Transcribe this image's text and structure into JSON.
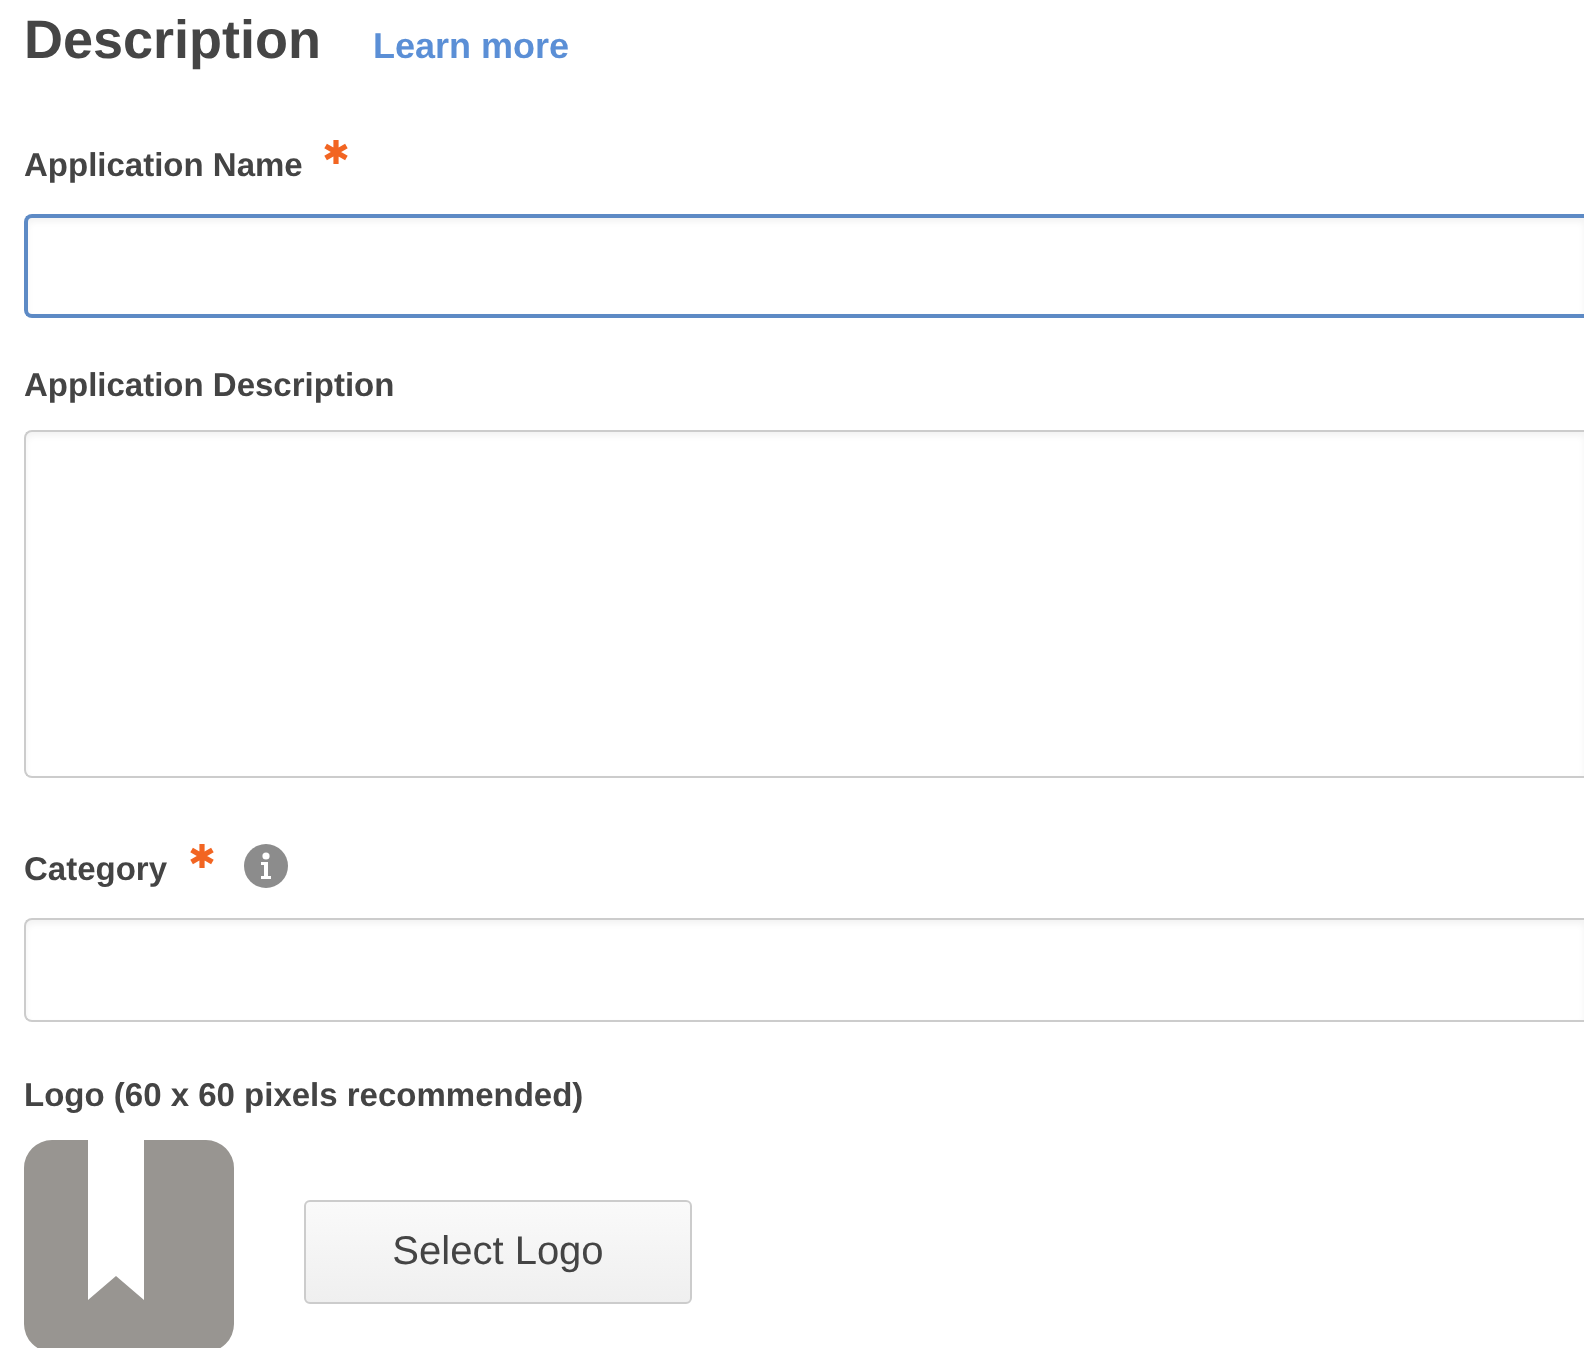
{
  "heading": {
    "title": "Description",
    "link": "Learn more"
  },
  "fields": [
    {
      "kind": "input",
      "label": "Application Name",
      "required": true,
      "info": false,
      "focused": true
    },
    {
      "kind": "textarea",
      "label": "Application Description",
      "required": false,
      "info": false,
      "focused": false
    },
    {
      "kind": "input",
      "label": "Category",
      "required": true,
      "info": true,
      "focused": false
    }
  ],
  "logo": {
    "label": "Logo (60 x 60 pixels recommended)",
    "button": "Select Logo"
  }
}
